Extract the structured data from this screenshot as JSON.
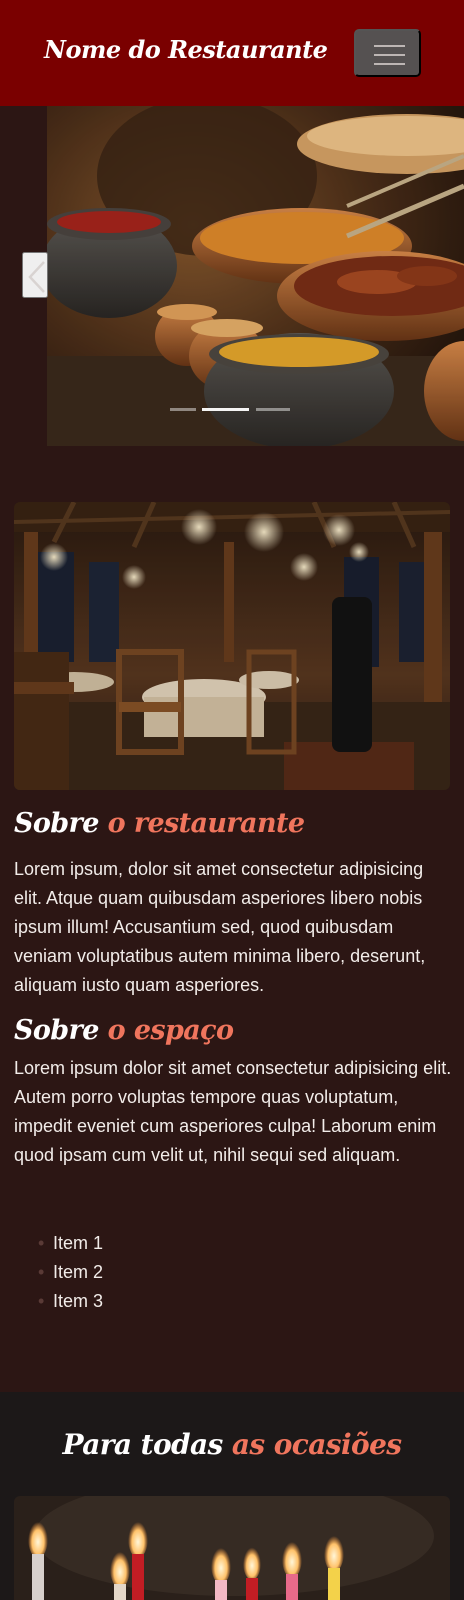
{
  "navbar": {
    "brand": "Nome do Restaurante",
    "toggle_icon": "hamburger-menu-icon"
  },
  "carousel": {
    "prev_icon": "chevron-left-icon",
    "slide_count": 3,
    "active_slide": 1
  },
  "about_restaurant": {
    "title_main": "Sobre",
    "title_accent": "o restaurante",
    "text": "Lorem ipsum, dolor sit amet consectetur adipisicing elit. Atque quam quibusdam asperiores libero nobis ipsum illum! Accusantium sed, quod quibusdam veniam voluptatibus autem minima libero, deserunt, aliquam iusto quam asperiores."
  },
  "about_space": {
    "title_main": "Sobre",
    "title_accent": "o espaço",
    "text": "Lorem ipsum dolor sit amet consectetur adipisicing elit. Autem porro voluptas tempore quas voluptatum, impedit eveniet cum asperiores culpa! Laborum enim quod ipsam cum velit ut, nihil sequi sed aliquam.",
    "items": [
      "Item 1",
      "Item 2",
      "Item 3"
    ]
  },
  "occasions": {
    "title_main": "Para todas",
    "title_accent": "as ocasiões"
  },
  "colors": {
    "navbar": "#7a0000",
    "page_background": "#2c1614",
    "accent": "#f0755d",
    "occasions_background": "#1c1818"
  }
}
